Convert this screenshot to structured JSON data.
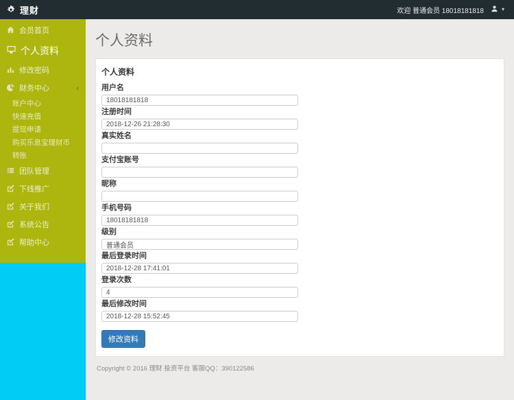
{
  "topbar": {
    "brand": "理财",
    "welcome": "欢迎 普通会员 18018181818",
    "brand_icon": "gear-icon",
    "user_icon": "user-icon",
    "caret_icon": "caret-down-icon"
  },
  "sidebar": {
    "items": [
      {
        "label": "会员首页",
        "icon": "home-icon"
      },
      {
        "label": "个人资料",
        "icon": "desktop-icon",
        "active": true
      },
      {
        "label": "修改密码",
        "icon": "bar-chart-icon"
      },
      {
        "label": "财务中心",
        "icon": "pie-chart-icon",
        "arrow": "‹"
      },
      {
        "label": "团队管理",
        "icon": "list-icon"
      },
      {
        "label": "下线推广",
        "icon": "edit-icon"
      },
      {
        "label": "关于我们",
        "icon": "edit-icon"
      },
      {
        "label": "系统公告",
        "icon": "edit-icon"
      },
      {
        "label": "帮助中心",
        "icon": "edit-icon"
      }
    ],
    "finance_submenu": [
      {
        "label": "账户中心"
      },
      {
        "label": "快速充值"
      },
      {
        "label": "提现申请"
      },
      {
        "label": "购买乐息宝理财币"
      },
      {
        "label": "转账"
      }
    ]
  },
  "content": {
    "page_title": "个人资料",
    "panel_title": "个人资料",
    "fields": [
      {
        "label": "用户名",
        "value": "18018181818"
      },
      {
        "label": "注册时间",
        "value": "2018-12-26 21:28:30"
      },
      {
        "label": "真实姓名",
        "value": ""
      },
      {
        "label": "支付宝账号",
        "value": ""
      },
      {
        "label": "昵称",
        "value": ""
      },
      {
        "label": "手机号码",
        "value": "18018181818"
      },
      {
        "label": "级别",
        "value": "普通会员"
      },
      {
        "label": "最后登录时间",
        "value": "2018-12-28 17:41:01"
      },
      {
        "label": "登录次数",
        "value": "4"
      },
      {
        "label": "最后修改时间",
        "value": "2018-12-28 15:52:45"
      }
    ],
    "submit_label": "修改资料"
  },
  "footer": {
    "text": "Copyright © 2016 理财 投资平台 客服QQ：390122586"
  },
  "colors": {
    "topbar_bg": "#222d32",
    "sidebar_menu_bg": "#adb50f",
    "sidebar_lower_bg": "#00ccf5",
    "content_bg": "#ecebe9",
    "primary_button": "#337ab7"
  }
}
